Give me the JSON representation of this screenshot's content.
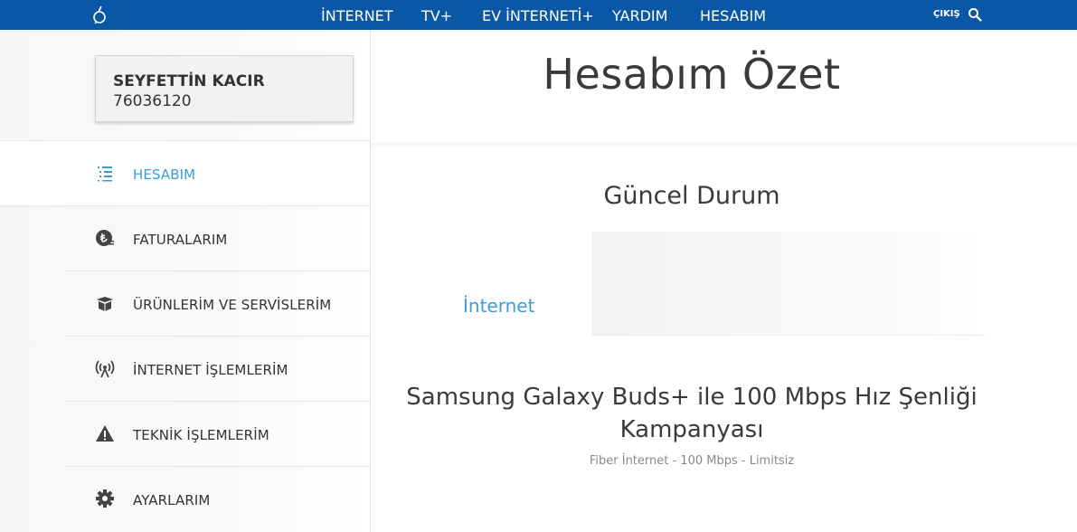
{
  "header": {
    "nav": [
      "İNTERNET",
      "TV+",
      "EV İNTERNETİ+",
      "YARDIM",
      "HESABIM"
    ],
    "logout_label": "ÇIKIŞ",
    "logo_icon": "brand-logo-icon",
    "search_icon": "search-icon"
  },
  "user": {
    "name": "SEYFETTİN KACIR",
    "number": "76036120"
  },
  "sidebar": {
    "items": [
      {
        "label": "HESABIM",
        "icon": "list-icon",
        "active": true
      },
      {
        "label": "FATURALARIM",
        "icon": "lira-coin-icon",
        "active": false
      },
      {
        "label": "ÜRÜNLERİM VE SERVİSLERİM",
        "icon": "box-icon",
        "active": false
      },
      {
        "label": "İNTERNET İŞLEMLERİM",
        "icon": "broadcast-icon",
        "active": false
      },
      {
        "label": "TEKNİK İŞLEMLERİM",
        "icon": "warning-icon",
        "active": false
      },
      {
        "label": "AYARLARIM",
        "icon": "gear-icon",
        "active": false
      }
    ]
  },
  "main": {
    "title": "Hesabım Özet",
    "section_title": "Güncel Durum",
    "tab_label": "İnternet",
    "campaign_title": "Samsung Galaxy Buds+ ile 100 Mbps Hız Şenliği Kampanyası",
    "campaign_subtitle": "Fiber İnternet - 100 Mbps - Limitsiz"
  },
  "colors": {
    "header_bg": "#0a58a5",
    "accent": "#3b9cd6",
    "text": "#333333"
  }
}
